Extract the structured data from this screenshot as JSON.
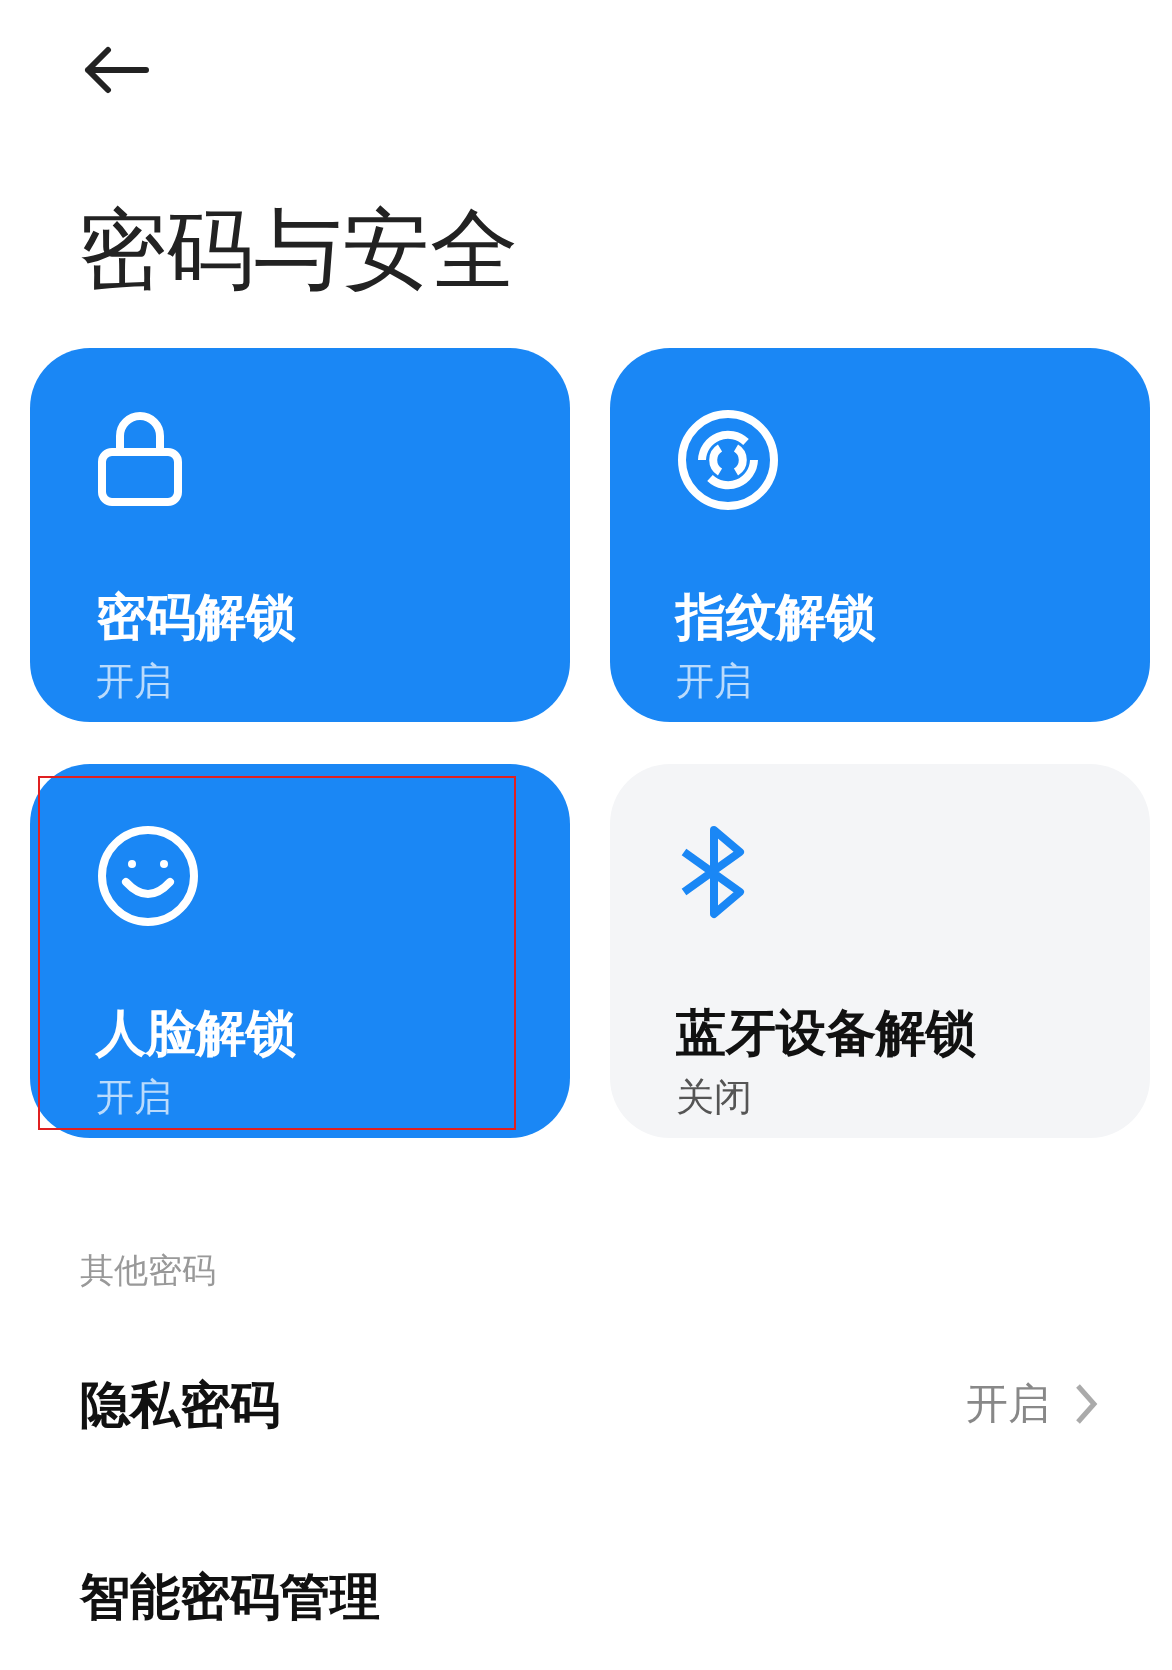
{
  "back": {
    "kind": "back"
  },
  "title": "密码与安全",
  "unlock_cards": [
    {
      "kind": "lock",
      "label": "密码解锁",
      "status": "开启",
      "on": true,
      "highlighted": false
    },
    {
      "kind": "fingerprint",
      "label": "指纹解锁",
      "status": "开启",
      "on": true,
      "highlighted": false
    },
    {
      "kind": "face",
      "label": "人脸解锁",
      "status": "开启",
      "on": true,
      "highlighted": true
    },
    {
      "kind": "bluetooth",
      "label": "蓝牙设备解锁",
      "status": "关闭",
      "on": false,
      "highlighted": false
    }
  ],
  "section_header": "其他密码",
  "list_items": [
    {
      "label": "隐私密码",
      "value": "开启",
      "chevron": true
    },
    {
      "label": "智能密码管理",
      "chevron": false
    }
  ]
}
